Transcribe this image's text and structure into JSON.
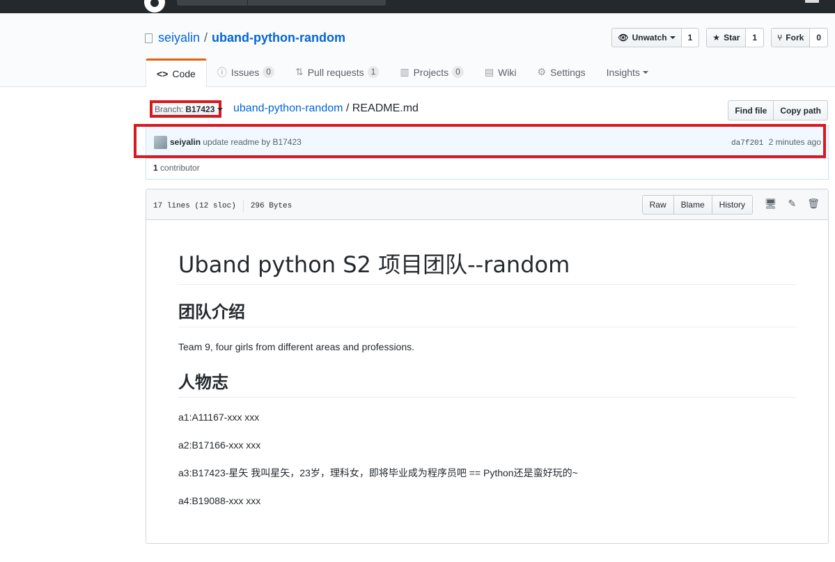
{
  "repo": {
    "owner": "seiyalin",
    "separator": "/",
    "name": "uband-python-random"
  },
  "actions": {
    "watch": {
      "label": "Unwatch",
      "count": "1"
    },
    "star": {
      "label": "Star",
      "count": "1"
    },
    "fork": {
      "label": "Fork",
      "count": "0"
    }
  },
  "tabs": [
    {
      "label": "Code",
      "icon": "code-icon"
    },
    {
      "label": "Issues",
      "counter": "0",
      "icon": "issue-icon"
    },
    {
      "label": "Pull requests",
      "counter": "1",
      "icon": "pull-request-icon"
    },
    {
      "label": "Projects",
      "counter": "0",
      "icon": "project-icon"
    },
    {
      "label": "Wiki",
      "icon": "book-icon"
    },
    {
      "label": "Settings",
      "icon": "gear-icon"
    },
    {
      "label": "Insights",
      "icon": "chevron-down-icon"
    }
  ],
  "file_nav": {
    "branch_label": "Branch:",
    "branch": "B17423",
    "path_repo": "uband-python-random",
    "path_sep": "/",
    "path_file": "README.md",
    "find_file": "Find file",
    "copy_path": "Copy path"
  },
  "commit": {
    "author": "seiyalin",
    "message": "update readme by B17423",
    "sha": "da7f201",
    "time": "2 minutes ago",
    "contributors_count": "1",
    "contributors_label": "contributor"
  },
  "file_header": {
    "lines": "17 lines (12 sloc)",
    "size": "296 Bytes",
    "raw": "Raw",
    "blame": "Blame",
    "history": "History"
  },
  "readme": {
    "h1": "Uband python S2 项目团队--random",
    "h2_team": "团队介绍",
    "team_desc": "Team 9, four girls from different areas and professions.",
    "h2_people": "人物志",
    "a1": "a1:A11167-xxx xxx",
    "a2": "a2:B17166-xxx xxx",
    "a3": "a3:B17423-星矢 我叫星矢，23岁，理科女，即将毕业成为程序员吧 == Python还是蛮好玩的~",
    "a4": "a4:B19088-xxx xxx"
  },
  "colors": {
    "highlight": "#d7191f",
    "accent_tab": "#e36209",
    "link": "#0366d6"
  }
}
